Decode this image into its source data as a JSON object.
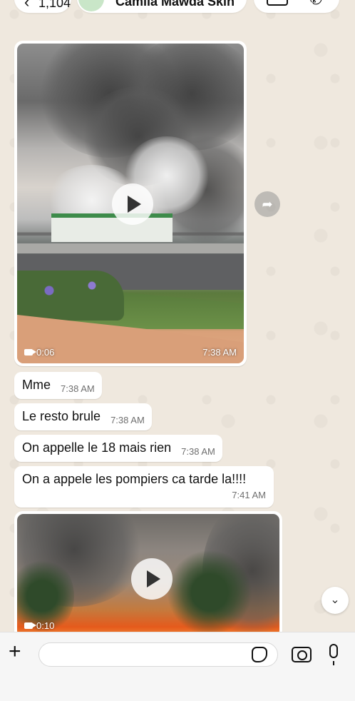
{
  "header": {
    "back_count": "1,104",
    "contact_name": "Camila Mawda Skin"
  },
  "messages": [
    {
      "type": "video",
      "duration": "0:06",
      "time": "7:38 AM"
    },
    {
      "type": "text",
      "text": "Mme",
      "time": "7:38 AM"
    },
    {
      "type": "text",
      "text": "Le resto brule",
      "time": "7:38 AM"
    },
    {
      "type": "text",
      "text": "On appelle le 18 mais rien",
      "time": "7:38 AM"
    },
    {
      "type": "text",
      "text": "On a appele les pompiers ca tarde la!!!!",
      "time": "7:41 AM"
    },
    {
      "type": "video",
      "duration": "0:10"
    }
  ],
  "input": {
    "placeholder": ""
  },
  "icons": {
    "back": "chevron-left-icon",
    "video_call": "video-camera-icon",
    "voice_call": "phone-icon",
    "play": "play-icon",
    "forward": "forward-icon",
    "scroll_down": "chevron-down-icon",
    "attach": "plus-icon",
    "sticker": "sticker-icon",
    "camera": "camera-icon",
    "mic": "microphone-icon"
  }
}
